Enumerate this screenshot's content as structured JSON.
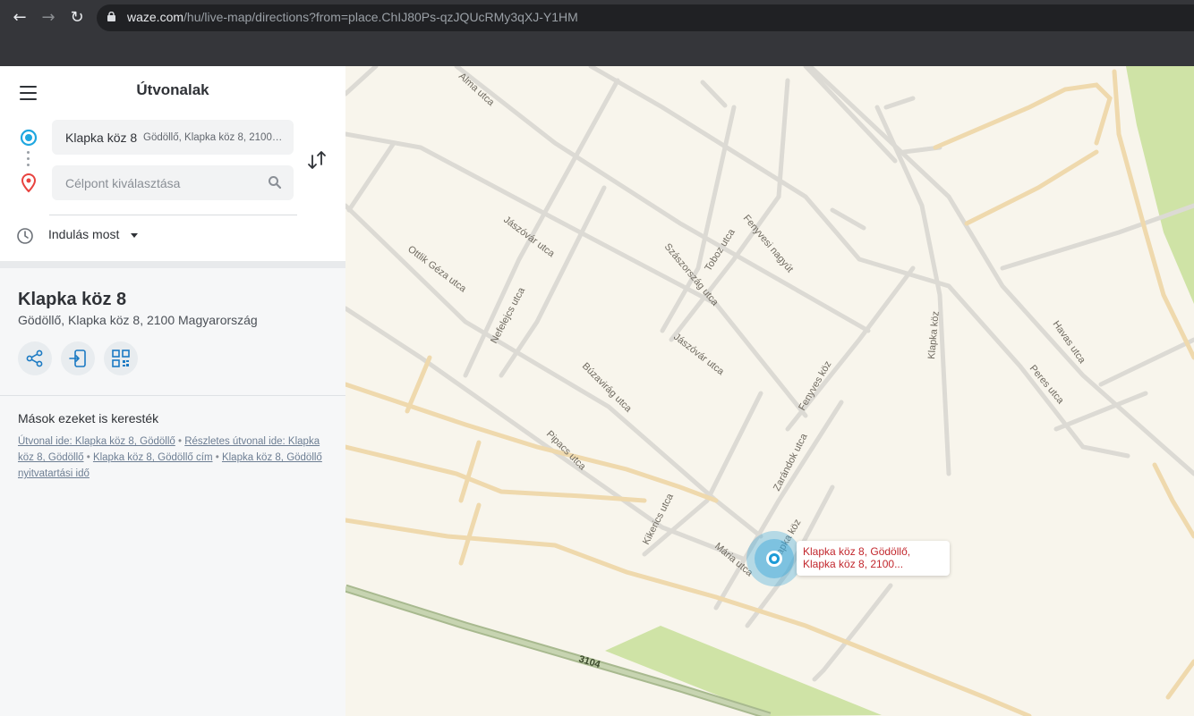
{
  "browser": {
    "domain": "waze.com",
    "path": "/hu/live-map/directions?from=place.ChIJ80Ps-qzJQUcRMy3qXJ-Y1HM",
    "icons": [
      "back-arrow-icon",
      "forward-arrow-icon",
      "reload-icon",
      "lock-icon"
    ]
  },
  "panel": {
    "title": "Útvonalak",
    "from_value": "Klapka köz 8",
    "from_detail": "Gödöllő, Klapka köz 8, 2100 Magyarország",
    "to_placeholder": "Célpont kiválasztása",
    "departure": "Indulás most"
  },
  "place": {
    "name": "Klapka köz 8",
    "address": "Gödöllő, Klapka köz 8, 2100 Magyarország",
    "actions": [
      "share-icon",
      "send-to-phone-icon",
      "qr-code-icon"
    ]
  },
  "related": {
    "title": "Mások ezeket is keresték",
    "links": [
      "Útvonal ide: Klapka köz 8, Gödöllő",
      "Részletes útvonal ide: Klapka köz 8, Gödöllő",
      "Klapka köz 8, Gödöllő cím",
      "Klapka köz 8, Gödöllő nyitvatartási idő"
    ]
  },
  "map": {
    "streets": [
      "Alma utca",
      "Jászóvár utca",
      "Ottlik Géza utca",
      "Nefelejcs utca",
      "Szászország utca",
      "Toboz utca",
      "Fenyvesi nagyút",
      "Jászóvár utca",
      "Búzavirág utca",
      "Fenyves köz",
      "Pipacs utca",
      "Zarándok utca",
      "Kikerics utca",
      "Mária utca",
      "Klapka köz",
      "Klapka köz",
      "Havas utca",
      "Peres utca",
      "3104"
    ],
    "pin_label": "Klapka köz 8, Gödöllő, Klapka köz 8, 2100...",
    "colors": {
      "land": "#f8f5ec",
      "park": "#cfe3a6",
      "main_road": "#efd9ad",
      "highway": "#a8b98f",
      "pin": "#3aa7da"
    }
  }
}
